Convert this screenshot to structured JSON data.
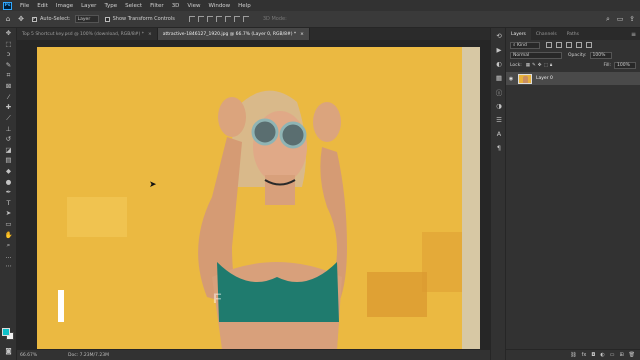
{
  "menu": [
    "File",
    "Edit",
    "Image",
    "Layer",
    "Type",
    "Select",
    "Filter",
    "3D",
    "View",
    "Window",
    "Help"
  ],
  "app_logo": "Ps",
  "options": {
    "auto_select_label": "Auto-Select:",
    "auto_select_target": "Layer",
    "transform_label": "Show Transform Controls",
    "mode_3d": "3D Mode:"
  },
  "tabs": [
    {
      "label": "Top 5 Shortcut key.psd @ 100% (download, RGB/8#) *",
      "close": "×"
    },
    {
      "label": "attractive-1846127_1920.jpg @ 66.7% (Layer 0, RGB/8#) *",
      "close": "×"
    }
  ],
  "status": {
    "zoom": "66.67%",
    "doc": "Doc: 7.23M/7.23M"
  },
  "canvas": {
    "overlay_letter": "F"
  },
  "layers_panel": {
    "tabs": [
      "Layers",
      "Channels",
      "Paths"
    ],
    "kind_label": "Kind",
    "blend_mode": "Normal",
    "opacity_label": "Opacity:",
    "opacity_value": "100%",
    "lock_label": "Lock:",
    "fill_label": "Fill:",
    "fill_value": "100%",
    "layers": [
      {
        "name": "Layer 0",
        "visible": true
      }
    ]
  },
  "colors": {
    "foreground": "#0fc0c8",
    "background": "#f2f2f2",
    "photo_backdrop": "#e9b43b"
  }
}
